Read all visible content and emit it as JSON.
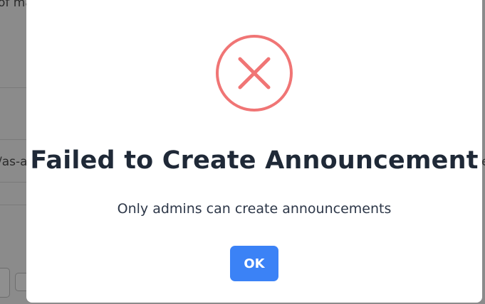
{
  "background": {
    "fragment_top": "of ma",
    "fragment_left": "/as-a",
    "fragment_right": "e"
  },
  "dialog": {
    "icon": "error-x-circle-icon",
    "title": "Failed to Create Announcement",
    "message": "Only admins can create announcements",
    "ok_label": "OK"
  },
  "colors": {
    "error_icon": "#f07575",
    "title_text": "#1f2937",
    "button_bg": "#3b82f6",
    "overlay": "#8b8b8b"
  }
}
